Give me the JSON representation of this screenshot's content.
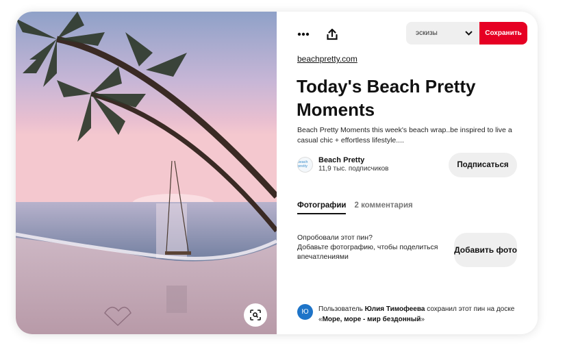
{
  "toolbar": {
    "more_icon": "ellipsis-icon",
    "share_icon": "share-upload-icon",
    "board_select_value": "эскизы",
    "save_label": "Сохранить"
  },
  "pin": {
    "source_link": "beachpretty.com",
    "title": "Today's Beach Pretty Moments",
    "description": "Beach Pretty Moments this week's beach wrap..be inspired to live a casual chic + effortless lifestyle....",
    "author": {
      "avatar_text": "beach pretty",
      "name": "Beach Pretty",
      "followers": "11,9 тыс. подписчиков",
      "follow_label": "Подписаться"
    }
  },
  "tabs": [
    {
      "label": "Фотографии"
    },
    {
      "label": "2 комментария"
    }
  ],
  "tried": {
    "line1": "Опробовали этот пин?",
    "line2": "Добавьте фотографию, чтобы поделиться впечатлениями",
    "button_label": "Добавить фото"
  },
  "activity": {
    "avatar_letter": "Ю",
    "prefix": "Пользователь ",
    "user": "Юлия Тимофеева",
    "middle": " сохранил этот пин на доске «",
    "board": "Море, море - мир бездонный",
    "suffix": "»"
  },
  "colors": {
    "save_red": "#e60023",
    "button_gray": "#efefef",
    "avatar_blue": "#1e74c8"
  }
}
